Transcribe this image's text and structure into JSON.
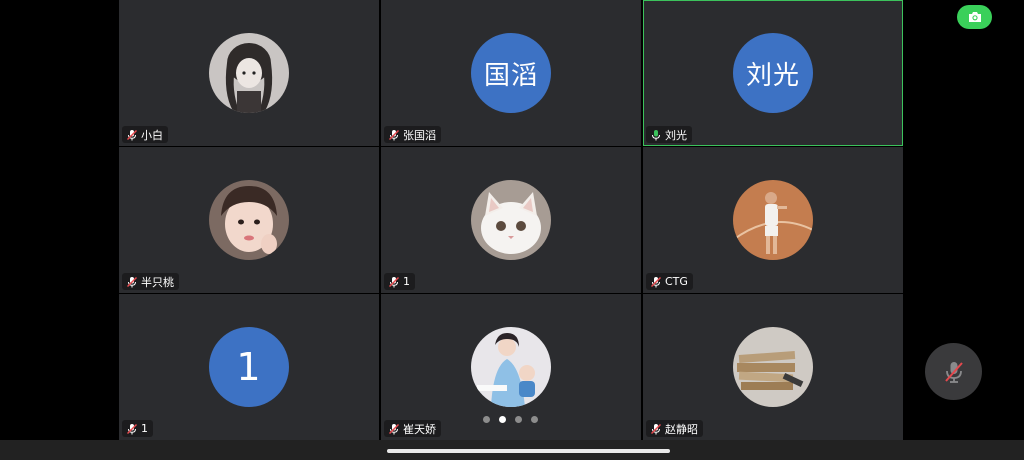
{
  "participants": [
    {
      "name": "小白",
      "avatar": "photo-anime-girl",
      "mic": "muted"
    },
    {
      "name": "张国滔",
      "avatar_text": "国滔",
      "mic": "muted"
    },
    {
      "name": "刘光",
      "avatar_text": "刘光",
      "mic": "active",
      "speaking": true
    },
    {
      "name": "半只桃",
      "avatar": "photo-girl-selfie",
      "mic": "muted"
    },
    {
      "name": "1",
      "avatar": "photo-white-cat",
      "mic": "muted"
    },
    {
      "name": "CTG",
      "avatar": "photo-basketball-player",
      "mic": "muted"
    },
    {
      "name": "1",
      "avatar_text": "1",
      "mic": "muted"
    },
    {
      "name": "崔天娇",
      "avatar": "photo-mother-child",
      "mic": "muted"
    },
    {
      "name": "赵静昭",
      "avatar": "photo-stacked-books",
      "mic": "muted"
    }
  ],
  "pagination": {
    "total_pages": 4,
    "current_page": 2
  },
  "controls": {
    "camera_icon": "camera-icon",
    "mic_icon": "mic-off-icon"
  },
  "colors": {
    "avatar_blue": "#3d72c4",
    "speaking_green": "#3cc25c",
    "muted_red": "#e5484d",
    "tile_bg": "#2b2c2f"
  }
}
